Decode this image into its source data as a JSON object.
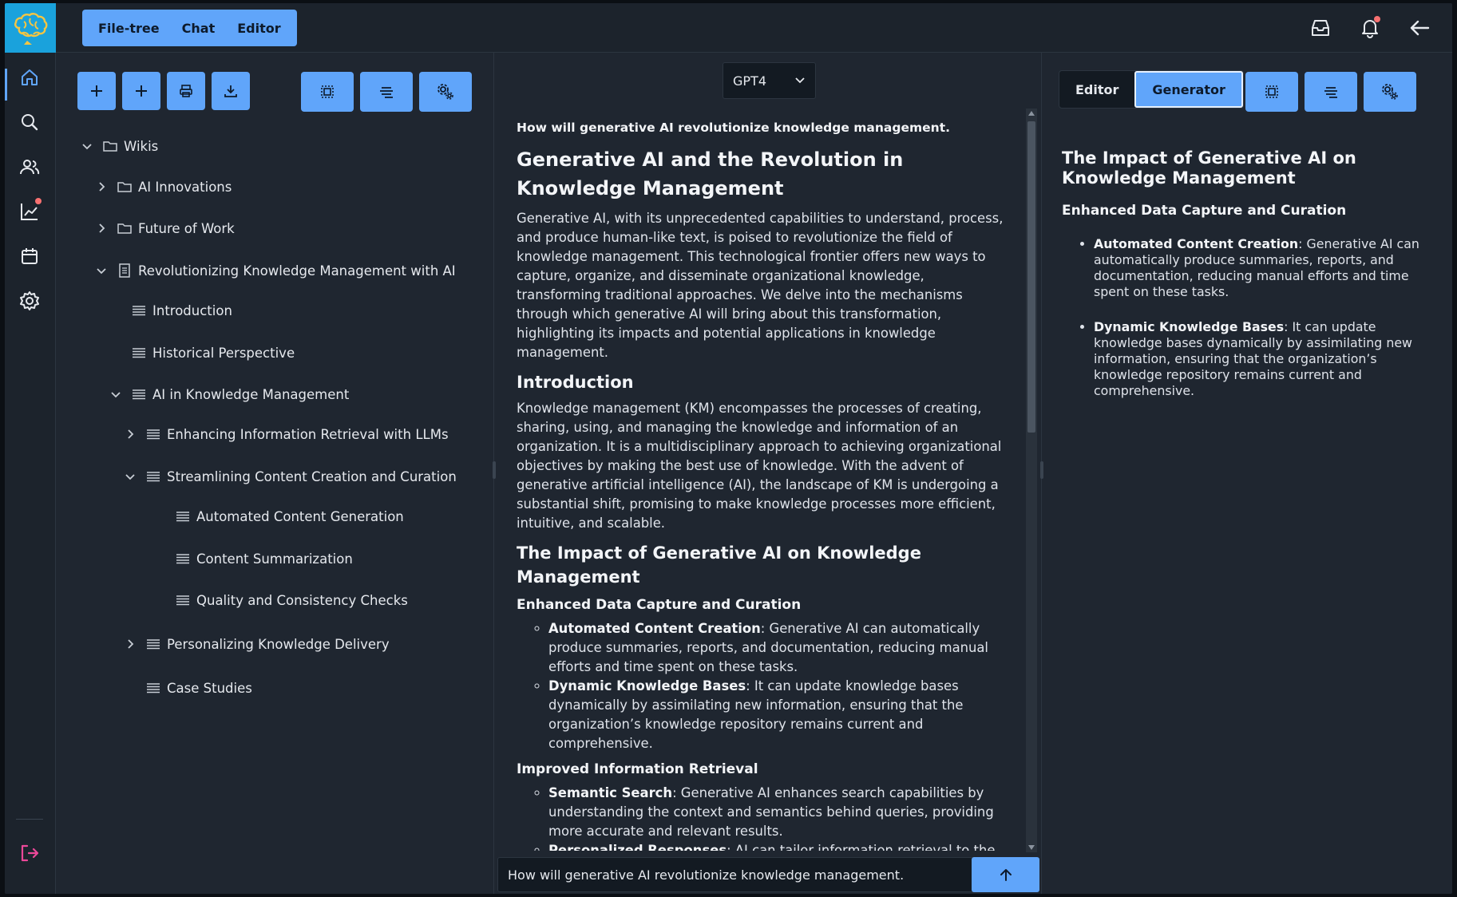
{
  "topbar": {
    "tabs": [
      "File-tree",
      "Chat",
      "Editor"
    ]
  },
  "rail": {
    "items": [
      "home-icon",
      "search-icon",
      "users-icon",
      "analytics-icon",
      "calendar-icon",
      "settings-icon"
    ],
    "bottom": "logout-icon"
  },
  "tree": {
    "nodes": [
      {
        "label": "Wikis"
      },
      {
        "label": "AI Innovations"
      },
      {
        "label": "Future of Work"
      },
      {
        "label": "Revolutionizing Knowledge Management with AI"
      },
      {
        "label": "Introduction"
      },
      {
        "label": "Historical Perspective"
      },
      {
        "label": "AI in Knowledge Management"
      },
      {
        "label": "Enhancing Information Retrieval with LLMs"
      },
      {
        "label": "Streamlining Content Creation and Curation"
      },
      {
        "label": "Automated Content Generation"
      },
      {
        "label": "Content Summarization"
      },
      {
        "label": "Quality and Consistency Checks"
      },
      {
        "label": "Personalizing Knowledge Delivery"
      },
      {
        "label": "Case Studies"
      }
    ]
  },
  "chat": {
    "model": "GPT4",
    "question": "How will generative AI revolutionize knowledge management.",
    "h1": "Generative AI and the Revolution in Knowledge Management",
    "p1": "Generative AI, with its unprecedented capabilities to understand, process, and produce human-like text, is poised to revolutionize the field of knowledge management. This technological frontier offers new ways to capture, organize, and disseminate organizational knowledge, transforming traditional approaches. We delve into the mechanisms through which generative AI will bring about this transformation, highlighting its impacts and potential applications in knowledge management.",
    "h_intro": "Introduction",
    "p_intro": "Knowledge management (KM) encompasses the processes of creating, sharing, using, and managing the knowledge and information of an organization. It is a multidisciplinary approach to achieving organizational objectives by making the best use of knowledge. With the advent of generative artificial intelligence (AI), the landscape of KM is undergoing a substantial shift, promising to make knowledge processes more efficient, intuitive, and scalable.",
    "h_impact": "The Impact of Generative AI on Knowledge Management",
    "h_capture": "Enhanced Data Capture and Curation",
    "capture_items": [
      {
        "term": "Automated Content Creation",
        "text": ": Generative AI can automatically produce summaries, reports, and documentation, reducing manual efforts and time spent on these tasks."
      },
      {
        "term": "Dynamic Knowledge Bases",
        "text": ": It can update knowledge bases dynamically by assimilating new information, ensuring that the organization’s knowledge repository remains current and comprehensive."
      }
    ],
    "h_retrieval": "Improved Information Retrieval",
    "retrieval_items": [
      {
        "term": "Semantic Search",
        "text": ": Generative AI enhances search capabilities by understanding the context and semantics behind queries, providing more accurate and relevant results."
      },
      {
        "term": "Personalized Responses",
        "text": ": AI can tailor information retrieval to the individual user’s context, history, and preferences, streamlining access to knowledge."
      }
    ],
    "input_value": "How will generative AI revolutionize knowledge management."
  },
  "editor": {
    "toggle": [
      "Editor",
      "Generator"
    ],
    "active": "Generator",
    "h2": "The Impact of Generative AI on Knowledge Management",
    "h3": "Enhanced Data Capture and Curation",
    "items": [
      {
        "term": "Automated Content Creation",
        "text": ": Generative AI can automatically produce summaries, reports, and documentation, reducing manual efforts and time spent on these tasks."
      },
      {
        "term": "Dynamic Knowledge Bases",
        "text": ": It can update knowledge bases dynamically by assimilating new information, ensuring that the organization’s knowledge repository remains current and comprehensive."
      }
    ]
  },
  "colors": {
    "accent": "#60a5fa",
    "background": "#1f2630",
    "logo_bg": "#1aa2dc",
    "notification": "#f87171"
  }
}
